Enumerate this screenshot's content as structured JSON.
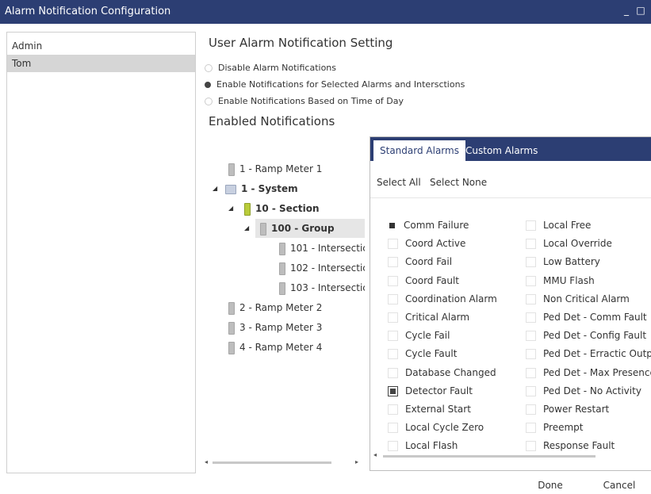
{
  "window": {
    "title": "Alarm Notification Configuration",
    "min_label": "_",
    "max_label": "□"
  },
  "users": [
    {
      "label": "Admin"
    },
    {
      "label": "Tom"
    }
  ],
  "setting": {
    "title": "User Alarm Notification Setting",
    "options": [
      {
        "label": "Disable Alarm Notifications"
      },
      {
        "label": "Enable Notifications for Selected Alarms and Intersctions"
      },
      {
        "label": "Enable Notifications Based on Time of Day"
      }
    ],
    "selected_index": 1
  },
  "enabled_title": "Enabled Notifications",
  "tree": [
    {
      "label": "1 - Ramp Meter 1"
    },
    {
      "label": "1 - System"
    },
    {
      "label": "10 - Section"
    },
    {
      "label": "100 - Group"
    },
    {
      "label": "101 - Intersectic"
    },
    {
      "label": "102 - Intersectic"
    },
    {
      "label": "103 - Intersectic"
    },
    {
      "label": "2 - Ramp Meter 2"
    },
    {
      "label": "3 - Ramp Meter 3"
    },
    {
      "label": "4 - Ramp Meter 4"
    }
  ],
  "tabs": {
    "standard": "Standard Alarms",
    "custom": "Custom Alarms"
  },
  "select_all": "Select All",
  "select_none": "Select None",
  "alarms_left": [
    {
      "label": "Comm Failure",
      "state": "partial"
    },
    {
      "label": "Coord Active",
      "state": "off"
    },
    {
      "label": "Coord Fail",
      "state": "off"
    },
    {
      "label": "Coord Fault",
      "state": "off"
    },
    {
      "label": "Coordination Alarm",
      "state": "off"
    },
    {
      "label": "Critical Alarm",
      "state": "off"
    },
    {
      "label": "Cycle Fail",
      "state": "off"
    },
    {
      "label": "Cycle Fault",
      "state": "off"
    },
    {
      "label": "Database Changed",
      "state": "off"
    },
    {
      "label": "Detector Fault",
      "state": "checked"
    },
    {
      "label": "External Start",
      "state": "off"
    },
    {
      "label": "Local Cycle Zero",
      "state": "off"
    },
    {
      "label": "Local Flash",
      "state": "off"
    }
  ],
  "alarms_right": [
    {
      "label": "Local Free",
      "state": "off"
    },
    {
      "label": "Local Override",
      "state": "off"
    },
    {
      "label": "Low Battery",
      "state": "off"
    },
    {
      "label": "MMU Flash",
      "state": "off"
    },
    {
      "label": "Non Critical Alarm",
      "state": "off"
    },
    {
      "label": "Ped Det - Comm Fault",
      "state": "off"
    },
    {
      "label": "Ped Det - Config Fault",
      "state": "off"
    },
    {
      "label": "Ped Det - Erractic Output",
      "state": "off"
    },
    {
      "label": "Ped Det - Max Presence",
      "state": "off"
    },
    {
      "label": "Ped Det - No Activity",
      "state": "off"
    },
    {
      "label": "Power Restart",
      "state": "off"
    },
    {
      "label": "Preempt",
      "state": "off"
    },
    {
      "label": "Response Fault",
      "state": "off"
    }
  ],
  "buttons": {
    "done": "Done",
    "cancel": "Cancel"
  }
}
